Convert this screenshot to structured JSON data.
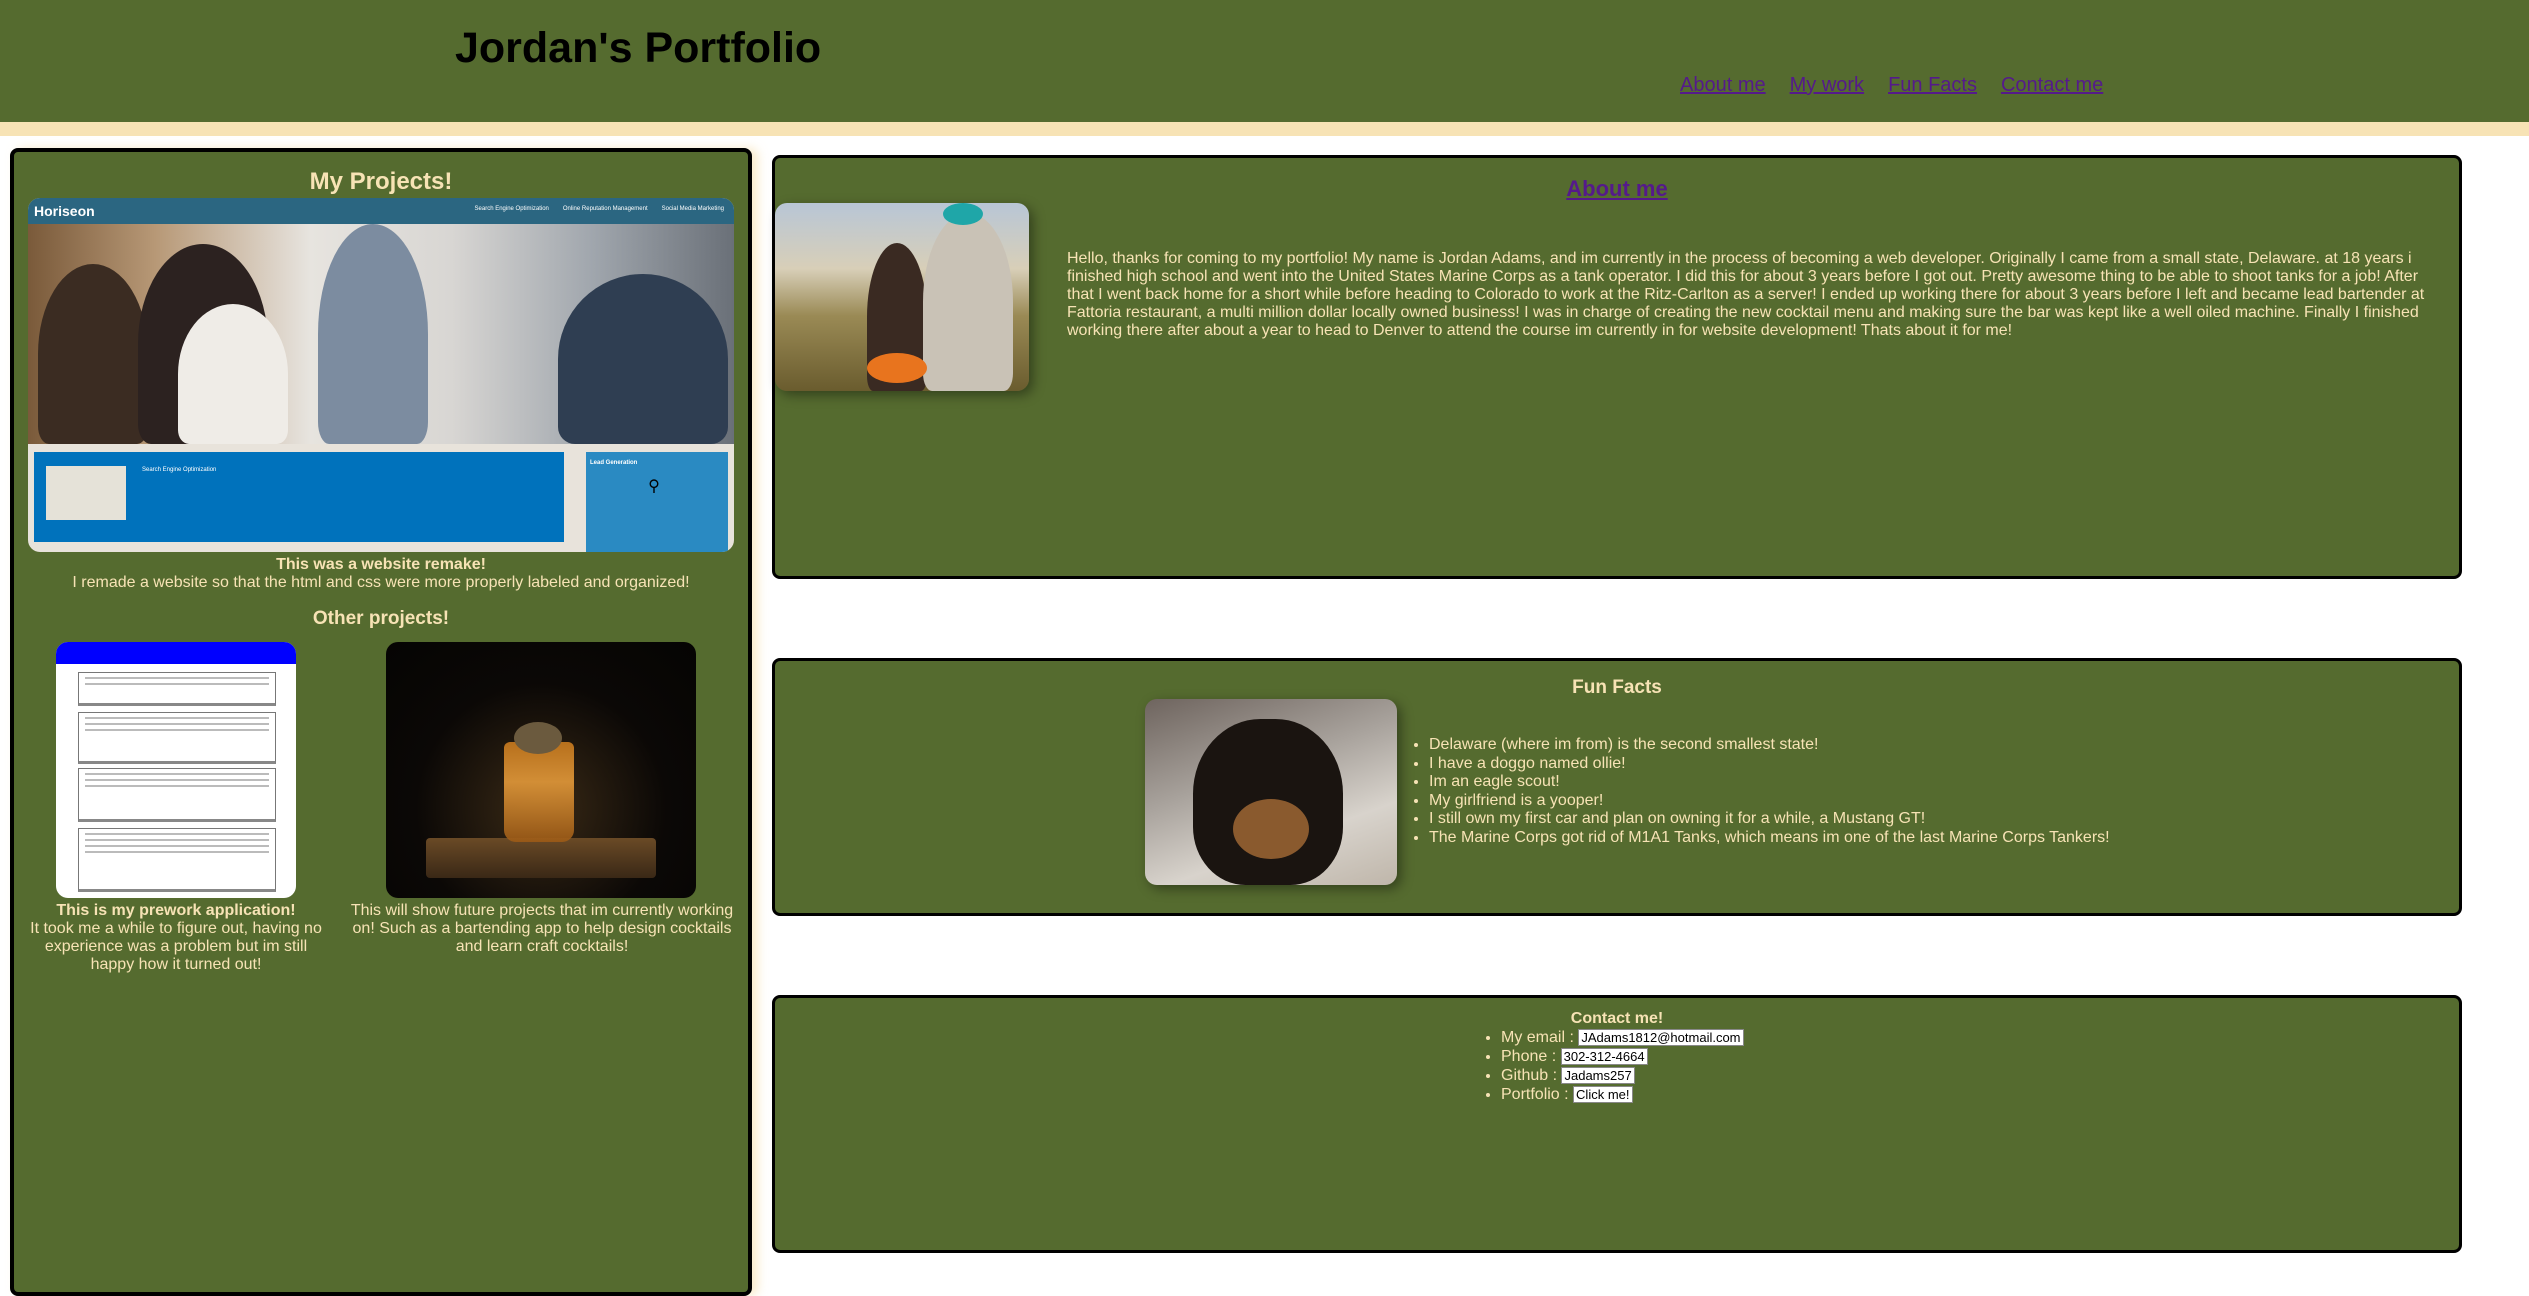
{
  "header": {
    "title": "Jordan's Portfolio",
    "nav": [
      "About me",
      "My work",
      "Fun Facts",
      "Contact me"
    ]
  },
  "projects": {
    "title": "My Projects!",
    "main_shot": {
      "logo": "Horiseon",
      "nav": [
        "Search Engine Optimization",
        "Online Reputation Management",
        "Social Media Marketing"
      ],
      "content_title": "Search Engine Optimization",
      "side_title": "Lead Generation"
    },
    "main_caption_bold": "This was a website remake!",
    "main_caption": "I remade a website so that the html and css were more properly labeled and organized!",
    "other_title": "Other projects!",
    "prework_caption_bold": "This is my prework application!",
    "prework_caption": "It took me a while to figure out, having no experience was a problem but im still happy how it turned out!",
    "future_caption": "This will show future projects that im currently working on! Such as a bartending app to help design cocktails and learn craft cocktails!"
  },
  "about": {
    "title": "About me",
    "text": "Hello, thanks for coming to my portfolio! My name is Jordan Adams, and im currently in the process of becoming a web developer. Originally I came from a small state, Delaware. at 18 years i finished high school and went into the United States Marine Corps as a tank operator. I did this for about 3 years before I got out. Pretty awesome thing to be able to shoot tanks for a job! After that I went back home for a short while before heading to Colorado to work at the Ritz-Carlton as a server! I ended up working there for about 3 years before I left and became lead bartender at Fattoria restaurant, a multi million dollar locally owned business! I was in charge of creating the new cocktail menu and making sure the bar was kept like a well oiled machine. Finally I finished working there after about a year to head to Denver to attend the course im currently in for website development! Thats about it for me!"
  },
  "fun_facts": {
    "title": "Fun Facts",
    "items": [
      "Delaware (where im from) is the second smallest state!",
      "I have a doggo named ollie!",
      "Im an eagle scout!",
      "My girlfriend is a yooper!",
      "I still own my first car and plan on owning it for a while, a Mustang GT!",
      "The Marine Corps got rid of M1A1 Tanks, which means im one of the last Marine Corps Tankers!"
    ]
  },
  "contact": {
    "title": "Contact me!",
    "items": [
      {
        "label": "My email :",
        "value": "JAdams1812@hotmail.com"
      },
      {
        "label": "Phone :",
        "value": "302-312-4664"
      },
      {
        "label": "Github :",
        "value": "Jadams257"
      },
      {
        "label": "Portfolio :",
        "value": "Click me!"
      }
    ]
  },
  "colors": {
    "header_bg": "#556b2f",
    "panel_bg": "#556b2f",
    "text": "#f7e3b5",
    "link": "#551a8b"
  }
}
